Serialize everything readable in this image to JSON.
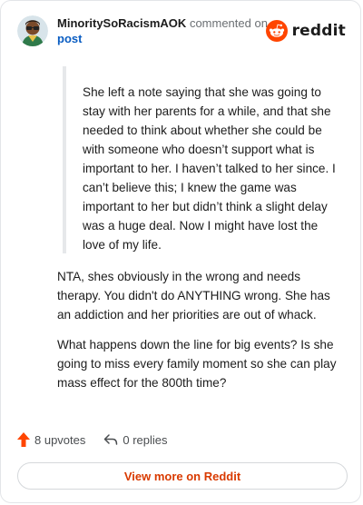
{
  "comment": {
    "author": "MinoritySoRacismAOK",
    "action": "commented on",
    "post_link": "post",
    "quote": "She left a note saying that she was going to stay with her parents for a while, and that she needed to think about whether she could be with someone who doesn’t support what is important to her. I haven’t talked to her since. I can’t believe this; I knew the game was important to her but didn’t think a slight delay was a huge deal. Now I might have lost the love of my life.",
    "paragraphs": [
      "NTA, shes obviously in the wrong and needs therapy. You didn't do ANYTHING wrong. She has an addiction and her priorities are out of whack.",
      "What happens down the line for big events? Is she going to miss every family moment so she can play mass effect for the 800th time?"
    ]
  },
  "brand": {
    "name": "reddit",
    "icon": "reddit-alien-icon",
    "accent": "#ff4500"
  },
  "stats": {
    "upvotes": "8 upvotes",
    "replies": "0 replies",
    "upvote_icon": "upvote-arrow-icon",
    "reply_icon": "reply-arrow-icon",
    "upvote_color": "#ff4500"
  },
  "footer": {
    "view_more": "View more on Reddit",
    "view_more_color": "#d93a00"
  }
}
